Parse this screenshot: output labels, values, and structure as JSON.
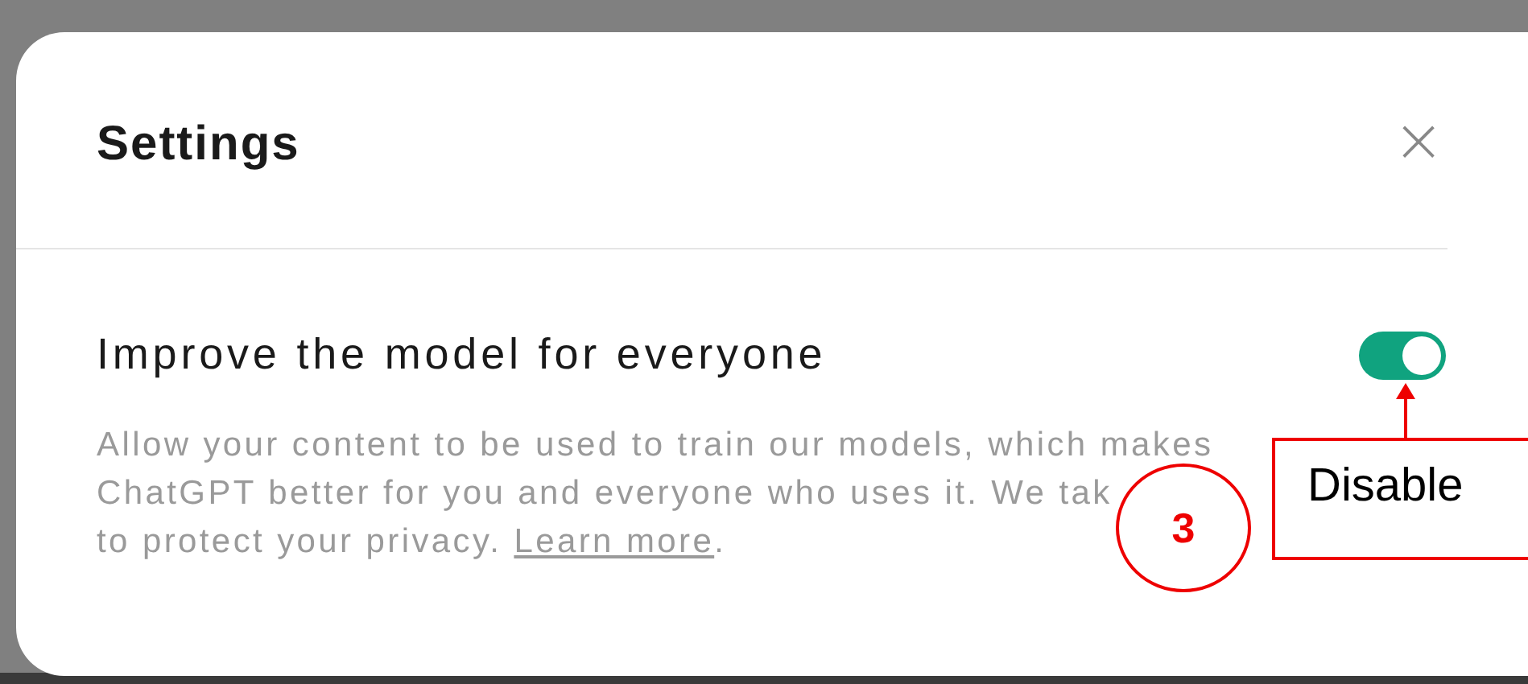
{
  "dialog": {
    "title": "Settings",
    "close": "×"
  },
  "setting": {
    "label": "Improve the model for everyone",
    "on": true,
    "description_lines": [
      "Allow your content to be used to train our models, which makes",
      "ChatGPT better for you and everyone who uses it. We tak"
    ],
    "last_line": "to protect your privacy. ",
    "link": "Learn more",
    "end": "."
  },
  "annotation": {
    "number": "3",
    "callout": "Disable"
  }
}
